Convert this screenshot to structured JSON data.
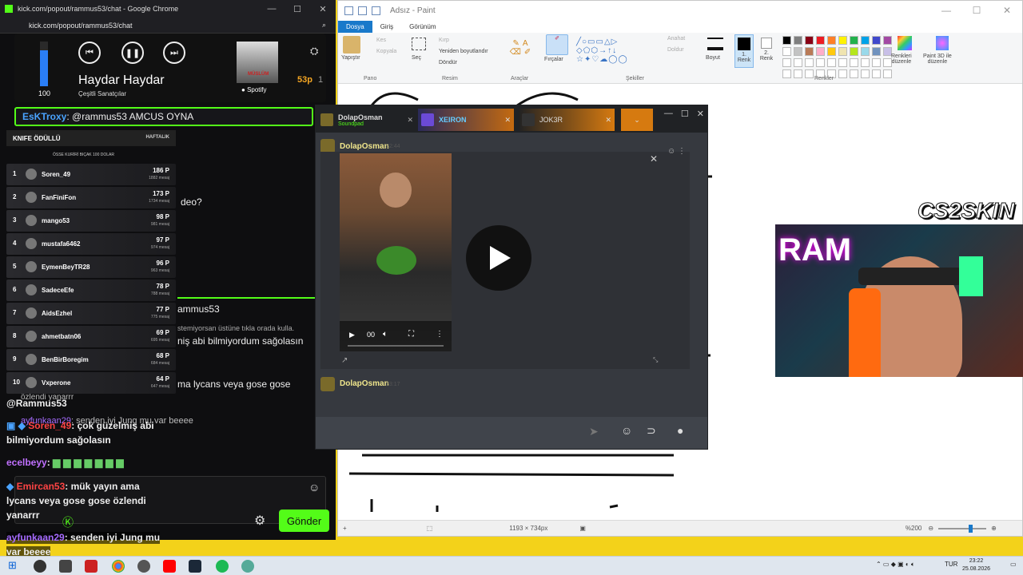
{
  "paint": {
    "title": "Adsız - Paint",
    "tabs": [
      "Dosya",
      "Giriş",
      "Görünüm"
    ],
    "clipboard": {
      "paste": "Yapıştır",
      "cut": "Kes",
      "copy": "Kopyala",
      "label": "Pano"
    },
    "image": {
      "select": "Seç",
      "crop": "Kırp",
      "resize": "Yeniden boyutlandır",
      "rotate": "Döndür",
      "label": "Resim"
    },
    "tools_label": "Araçlar",
    "brushes": "Fırçalar",
    "shapes": {
      "outline": "Anahat",
      "fill": "Doldur",
      "label": "Şekiller"
    },
    "size": "Boyut",
    "color1": [
      "1.",
      "Renk"
    ],
    "color2": [
      "2.",
      "Renk"
    ],
    "colors_label": "Renkler",
    "edit_colors": [
      "Renkleri",
      "düzenle"
    ],
    "paint3d": [
      "Paint 3D ile",
      "düzenle"
    ],
    "status": {
      "dimensions": "1193 × 734px",
      "zoom": "%200"
    },
    "palette": [
      "#000000",
      "#7f7f7f",
      "#880015",
      "#ed1c24",
      "#ff7f27",
      "#fff200",
      "#22b14c",
      "#00a2e8",
      "#3f48cc",
      "#a349a4",
      "#ffffff",
      "#c3c3c3",
      "#b97a57",
      "#ffaec9",
      "#ffc90e",
      "#efe4b0",
      "#b5e61d",
      "#99d9ea",
      "#7092be",
      "#c8bfe7"
    ]
  },
  "chrome": {
    "title": "kick.com/popout/rammus53/chat - Google Chrome",
    "url": "kick.com/popout/rammus53/chat"
  },
  "spotify": {
    "volume": "100",
    "volume_level": 0.8,
    "track": "Haydar Haydar",
    "artist": "Çeşitli Sanatçılar",
    "brand": "Spotify",
    "album_text": "MÜSLÜM",
    "points": "53p",
    "points_suffix": "1"
  },
  "chat": {
    "pinned_user": "EsKTroxy",
    "pinned_text": ": @rammus53 AMCUS OYNA",
    "line_video": "deo?",
    "line_rammus": "ammus53",
    "line_hint": "stemiyorsan üstüne tıkla orada kulla.",
    "line_thanks": "niş abi bilmiyordum sağolasın",
    "line_lycans": "ma lycans veya gose gose",
    "line_ozlendi": "özlendi yanarrr",
    "mention": "@Rammus53",
    "msg1_user": "ayfunkaan29",
    "msg1_text": ": senden iyi Jung mu var beeee",
    "msg2_user": "Soren_49",
    "msg2_text": ": çok güzelmiş abi",
    "msg2_cont": "bilmiyordum sağolasın",
    "msg3_user": "ecelbeyy",
    "msg3_text": ":",
    "msg4_user": "Emircan53",
    "msg4_text": ": mük yayın ama",
    "msg4_cont1": "lycans veya gose gose özlendi",
    "msg4_cont2": "yanarrr",
    "msg5_user": "ayfunkaan29",
    "msg5_text": ": senden iyi Jung mu",
    "msg5_cont": "var beeee",
    "send": "Gönder"
  },
  "board": {
    "title": "KNIFE ÖDÜLLÜ",
    "period": "HAFTALIK",
    "subtitle": "ÖSSE KURİRİ BIÇAK 100 DOLAR",
    "rows": [
      {
        "rank": "1",
        "name": "Soren_49",
        "points": "186 P",
        "msgs": "1882 mesaj"
      },
      {
        "rank": "2",
        "name": "FanFiniFon",
        "points": "173 P",
        "msgs": "1734 mesaj"
      },
      {
        "rank": "3",
        "name": "mango53",
        "points": "98 P",
        "msgs": "981 mesaj"
      },
      {
        "rank": "4",
        "name": "mustafa6462",
        "points": "97 P",
        "msgs": "974 mesaj"
      },
      {
        "rank": "5",
        "name": "EymenBeyTR28",
        "points": "96 P",
        "msgs": "963 mesaj"
      },
      {
        "rank": "6",
        "name": "SadeceEfe",
        "points": "78 P",
        "msgs": "788 mesaj"
      },
      {
        "rank": "7",
        "name": "AidsEzhel",
        "points": "77 P",
        "msgs": "775 mesaj"
      },
      {
        "rank": "8",
        "name": "ahmetbatn06",
        "points": "69 P",
        "msgs": "695 mesaj"
      },
      {
        "rank": "9",
        "name": "BenBirBoregim",
        "points": "68 P",
        "msgs": "684 mesaj"
      },
      {
        "rank": "10",
        "name": "Vxperone",
        "points": "64 P",
        "msgs": "647 mesaj"
      }
    ]
  },
  "discord": {
    "tab1_name": "DolapOsman",
    "tab1_sub": "Soundpad",
    "tab2_name": "XEIRON",
    "tab3_name": "JOK3R",
    "msg_user": "DolapOsman",
    "msg_time": "22:44",
    "msg2_user": "DolapOsman",
    "msg2_time": "23:17",
    "video_time": "00"
  },
  "overlay": {
    "brand": "CS2SKIN",
    "cam_text": "RAM"
  },
  "taskbar": {
    "time": "23:22",
    "date": "25.08.2026",
    "lang": "TUR"
  }
}
